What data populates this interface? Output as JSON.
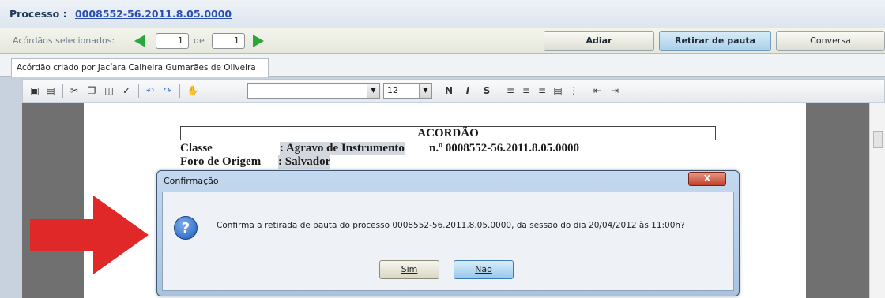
{
  "process": {
    "label": "Processo :",
    "number": "0008552-56.2011.8.05.0000"
  },
  "selection": {
    "label": "Acórdãos selecionados:",
    "current": "1",
    "of_label": "de",
    "total": "1"
  },
  "actions": {
    "adiar": "Adiar",
    "retirar": "Retirar de pauta",
    "conversa": "Conversa"
  },
  "tab": {
    "label": "Acórdão criado por Jacíara Calheira Gumarães de Oliveira"
  },
  "toolbar": {
    "font_size": "12",
    "bold": "N",
    "italic": "I",
    "underline": "S",
    "icons": [
      "save-icon",
      "document-icon",
      "cut-icon",
      "copy-icon",
      "paste-icon",
      "format-brush-icon",
      "undo-icon",
      "redo-icon",
      "hand-icon",
      "align-left-icon",
      "align-center-icon",
      "align-right-icon",
      "justify-icon",
      "bullet-list-icon",
      "outdent-icon",
      "indent-icon"
    ]
  },
  "document": {
    "title": "ACORDÃO",
    "classe_label": "Classe",
    "classe_value": ": Agravo de Instrumento",
    "classe_number": "n.º 0008552-56.2011.8.05.0000",
    "foro_label": "Foro de Origem",
    "foro_value": ": Salvador"
  },
  "dialog": {
    "title": "Confirmação",
    "close": "X",
    "message": "Confirma a retirada de pauta do processo 0008552-56.2011.8.05.0000, da sessão do dia 20/04/2012 às 11:00h?",
    "yes": "Sim",
    "no": "Não"
  },
  "colors": {
    "accent_blue": "#2b4fb0",
    "arrow_green": "#2aa63c",
    "annotation_red": "#e02828"
  }
}
